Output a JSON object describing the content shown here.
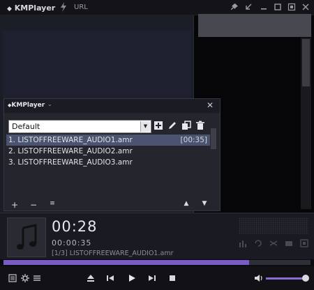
{
  "app": {
    "title_k": "KM",
    "title_rest": "Player",
    "url_label": "URL"
  },
  "playlist": {
    "title_k": "KM",
    "title_rest": "Player",
    "selected_list": "Default",
    "items": [
      {
        "label": "1. LISTOFFREEWARE_AUDIO1.amr",
        "duration": "[00:35]",
        "selected": true
      },
      {
        "label": "2. LISTOFFREEWARE_AUDIO2.amr",
        "duration": "",
        "selected": false
      },
      {
        "label": "3. LISTOFFREEWARE_AUDIO3.amr",
        "duration": "",
        "selected": false
      }
    ]
  },
  "player": {
    "elapsed": "00:28",
    "total": "00:00:35",
    "now_playing": "[1/3] LISTOFFREEWARE_AUDIO1.amr",
    "progress": 0.8,
    "volume": 0.95
  },
  "icons": {
    "title_bar": [
      "lightning-icon",
      "pin-icon",
      "restore-icon",
      "minimize-icon",
      "maximize-icon",
      "fullscreen-icon",
      "close-icon"
    ],
    "playlist_tools": [
      "add-icon",
      "edit-icon",
      "copy-icon",
      "delete-icon"
    ],
    "controls": [
      "playlist-icon",
      "settings-icon",
      "menu-icon",
      "eject-icon",
      "previous-icon",
      "play-icon",
      "next-icon",
      "stop-icon",
      "volume-icon"
    ]
  },
  "colors": {
    "accent": "#7a5cc8",
    "selection": "#4a5470"
  }
}
